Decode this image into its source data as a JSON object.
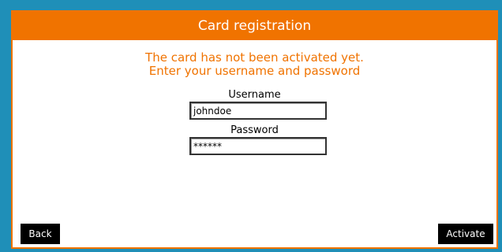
{
  "header": {
    "title": "Card registration"
  },
  "message": {
    "line1": "The card has not been activated yet.",
    "line2": "Enter your username and password"
  },
  "form": {
    "username_label": "Username",
    "username_value": "johndoe",
    "password_label": "Password",
    "password_value": "******"
  },
  "buttons": {
    "back_label": "Back",
    "activate_label": "Activate"
  },
  "colors": {
    "accent": "#f07300",
    "background": "#1f8fb8",
    "button": "#000000"
  }
}
